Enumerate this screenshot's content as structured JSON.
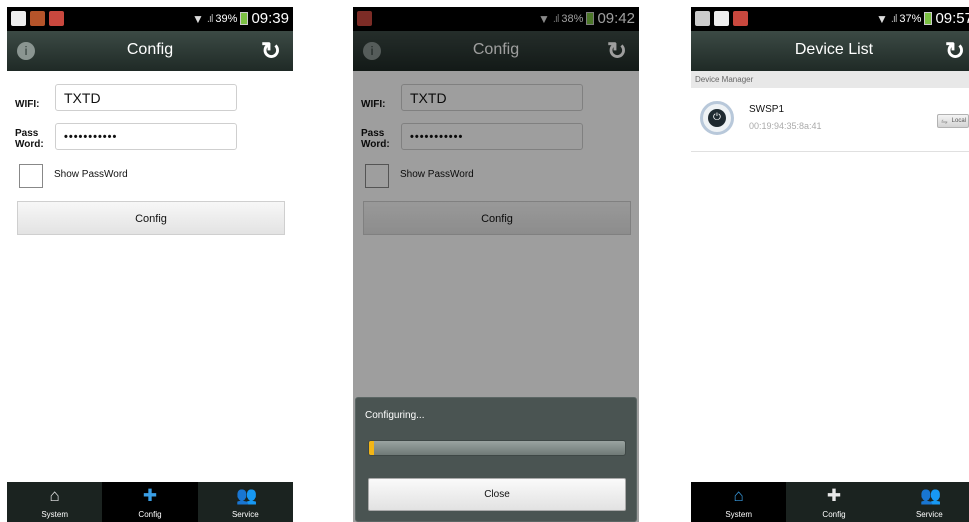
{
  "screens": [
    {
      "status": {
        "battery": "39%",
        "time": "09:39"
      },
      "title": "Config",
      "form": {
        "wifi_label": "WIFI:",
        "wifi_value": "TXTD",
        "pass_label_1": "Pass",
        "pass_label_2": "Word:",
        "pass_value": "•••••••••••",
        "show_password": "Show PassWord",
        "button": "Config"
      },
      "nav": [
        "System",
        "Config",
        "Service"
      ]
    },
    {
      "status": {
        "battery": "38%",
        "time": "09:42"
      },
      "title": "Config",
      "form": {
        "wifi_label": "WIFI:",
        "wifi_value": "TXTD",
        "pass_label_1": "Pass",
        "pass_label_2": "Word:",
        "pass_value": "•••••••••••",
        "show_password": "Show PassWord",
        "button": "Config"
      },
      "dialog": {
        "title": "Configuring...",
        "progress_percent": 2,
        "close": "Close"
      }
    },
    {
      "status": {
        "battery": "37%",
        "time": "09:57"
      },
      "title": "Device List",
      "section": "Device Manager",
      "device": {
        "name": "SWSP1",
        "mac": "00:19:94:35:8a:41",
        "mode": "Local"
      },
      "nav": [
        "System",
        "Config",
        "Service"
      ]
    }
  ],
  "colors": {
    "accent": "#3a9ee4",
    "progress": "#f2b516",
    "bar": "#1b2320"
  },
  "icons": {
    "info": "info-icon",
    "refresh": "refresh-icon",
    "home": "home-icon",
    "puzzle": "puzzle-icon",
    "users": "users-icon",
    "device": "plug-device-icon"
  }
}
